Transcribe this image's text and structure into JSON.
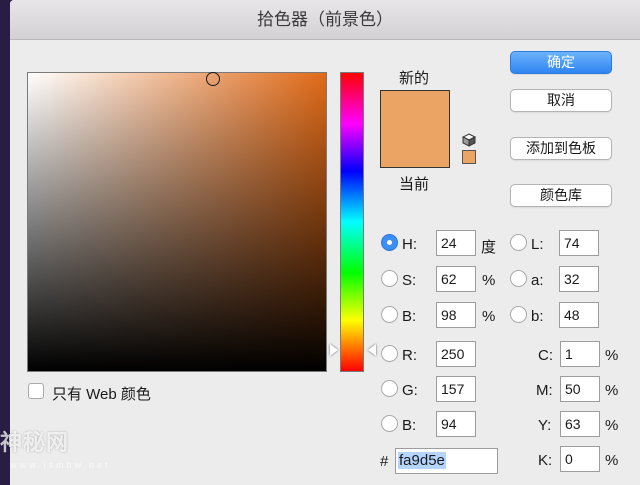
{
  "window": {
    "title": "拾色器（前景色）"
  },
  "colors": {
    "new_swatch": "#eca464",
    "current_swatch": "#eca464",
    "accent_button": "#2d84f3"
  },
  "labels": {
    "new": "新的",
    "current": "当前",
    "web_only": "只有 Web 颜色"
  },
  "buttons": {
    "ok": "确定",
    "cancel": "取消",
    "add_to_swatches": "添加到色板",
    "color_libraries": "颜色库"
  },
  "fields": {
    "H": {
      "label": "H:",
      "value": "24",
      "unit": "度"
    },
    "S": {
      "label": "S:",
      "value": "62",
      "unit": "%"
    },
    "B": {
      "label": "B:",
      "value": "98",
      "unit": "%"
    },
    "R": {
      "label": "R:",
      "value": "250"
    },
    "G": {
      "label": "G:",
      "value": "157"
    },
    "Bl": {
      "label": "B:",
      "value": "94"
    },
    "L": {
      "label": "L:",
      "value": "74"
    },
    "a": {
      "label": "a:",
      "value": "32"
    },
    "b": {
      "label": "b:",
      "value": "48"
    },
    "C": {
      "label": "C:",
      "value": "1",
      "unit": "%"
    },
    "M": {
      "label": "M:",
      "value": "50",
      "unit": "%"
    },
    "Y": {
      "label": "Y:",
      "value": "63",
      "unit": "%"
    },
    "K": {
      "label": "K:",
      "value": "0",
      "unit": "%"
    }
  },
  "hex": {
    "prefix": "#",
    "value": "fa9d5e"
  },
  "icons": {
    "gamut_warning": "cube-icon",
    "web_safe_swatch": "small-swatch-icon"
  },
  "watermark": {
    "text": "神秘网",
    "subtext": "www.ismbw.net"
  }
}
